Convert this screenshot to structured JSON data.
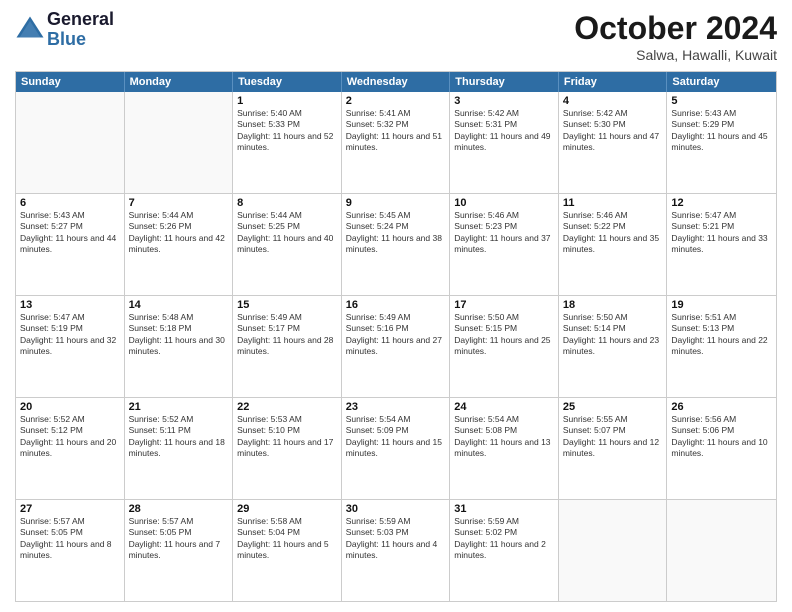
{
  "logo": {
    "line1": "General",
    "line2": "Blue"
  },
  "title": "October 2024",
  "subtitle": "Salwa, Hawalli, Kuwait",
  "days": [
    "Sunday",
    "Monday",
    "Tuesday",
    "Wednesday",
    "Thursday",
    "Friday",
    "Saturday"
  ],
  "weeks": [
    [
      {
        "day": "",
        "sunrise": "",
        "sunset": "",
        "daylight": "",
        "empty": true
      },
      {
        "day": "",
        "sunrise": "",
        "sunset": "",
        "daylight": "",
        "empty": true
      },
      {
        "day": "1",
        "sunrise": "Sunrise: 5:40 AM",
        "sunset": "Sunset: 5:33 PM",
        "daylight": "Daylight: 11 hours and 52 minutes."
      },
      {
        "day": "2",
        "sunrise": "Sunrise: 5:41 AM",
        "sunset": "Sunset: 5:32 PM",
        "daylight": "Daylight: 11 hours and 51 minutes."
      },
      {
        "day": "3",
        "sunrise": "Sunrise: 5:42 AM",
        "sunset": "Sunset: 5:31 PM",
        "daylight": "Daylight: 11 hours and 49 minutes."
      },
      {
        "day": "4",
        "sunrise": "Sunrise: 5:42 AM",
        "sunset": "Sunset: 5:30 PM",
        "daylight": "Daylight: 11 hours and 47 minutes."
      },
      {
        "day": "5",
        "sunrise": "Sunrise: 5:43 AM",
        "sunset": "Sunset: 5:29 PM",
        "daylight": "Daylight: 11 hours and 45 minutes."
      }
    ],
    [
      {
        "day": "6",
        "sunrise": "Sunrise: 5:43 AM",
        "sunset": "Sunset: 5:27 PM",
        "daylight": "Daylight: 11 hours and 44 minutes."
      },
      {
        "day": "7",
        "sunrise": "Sunrise: 5:44 AM",
        "sunset": "Sunset: 5:26 PM",
        "daylight": "Daylight: 11 hours and 42 minutes."
      },
      {
        "day": "8",
        "sunrise": "Sunrise: 5:44 AM",
        "sunset": "Sunset: 5:25 PM",
        "daylight": "Daylight: 11 hours and 40 minutes."
      },
      {
        "day": "9",
        "sunrise": "Sunrise: 5:45 AM",
        "sunset": "Sunset: 5:24 PM",
        "daylight": "Daylight: 11 hours and 38 minutes."
      },
      {
        "day": "10",
        "sunrise": "Sunrise: 5:46 AM",
        "sunset": "Sunset: 5:23 PM",
        "daylight": "Daylight: 11 hours and 37 minutes."
      },
      {
        "day": "11",
        "sunrise": "Sunrise: 5:46 AM",
        "sunset": "Sunset: 5:22 PM",
        "daylight": "Daylight: 11 hours and 35 minutes."
      },
      {
        "day": "12",
        "sunrise": "Sunrise: 5:47 AM",
        "sunset": "Sunset: 5:21 PM",
        "daylight": "Daylight: 11 hours and 33 minutes."
      }
    ],
    [
      {
        "day": "13",
        "sunrise": "Sunrise: 5:47 AM",
        "sunset": "Sunset: 5:19 PM",
        "daylight": "Daylight: 11 hours and 32 minutes."
      },
      {
        "day": "14",
        "sunrise": "Sunrise: 5:48 AM",
        "sunset": "Sunset: 5:18 PM",
        "daylight": "Daylight: 11 hours and 30 minutes."
      },
      {
        "day": "15",
        "sunrise": "Sunrise: 5:49 AM",
        "sunset": "Sunset: 5:17 PM",
        "daylight": "Daylight: 11 hours and 28 minutes."
      },
      {
        "day": "16",
        "sunrise": "Sunrise: 5:49 AM",
        "sunset": "Sunset: 5:16 PM",
        "daylight": "Daylight: 11 hours and 27 minutes."
      },
      {
        "day": "17",
        "sunrise": "Sunrise: 5:50 AM",
        "sunset": "Sunset: 5:15 PM",
        "daylight": "Daylight: 11 hours and 25 minutes."
      },
      {
        "day": "18",
        "sunrise": "Sunrise: 5:50 AM",
        "sunset": "Sunset: 5:14 PM",
        "daylight": "Daylight: 11 hours and 23 minutes."
      },
      {
        "day": "19",
        "sunrise": "Sunrise: 5:51 AM",
        "sunset": "Sunset: 5:13 PM",
        "daylight": "Daylight: 11 hours and 22 minutes."
      }
    ],
    [
      {
        "day": "20",
        "sunrise": "Sunrise: 5:52 AM",
        "sunset": "Sunset: 5:12 PM",
        "daylight": "Daylight: 11 hours and 20 minutes."
      },
      {
        "day": "21",
        "sunrise": "Sunrise: 5:52 AM",
        "sunset": "Sunset: 5:11 PM",
        "daylight": "Daylight: 11 hours and 18 minutes."
      },
      {
        "day": "22",
        "sunrise": "Sunrise: 5:53 AM",
        "sunset": "Sunset: 5:10 PM",
        "daylight": "Daylight: 11 hours and 17 minutes."
      },
      {
        "day": "23",
        "sunrise": "Sunrise: 5:54 AM",
        "sunset": "Sunset: 5:09 PM",
        "daylight": "Daylight: 11 hours and 15 minutes."
      },
      {
        "day": "24",
        "sunrise": "Sunrise: 5:54 AM",
        "sunset": "Sunset: 5:08 PM",
        "daylight": "Daylight: 11 hours and 13 minutes."
      },
      {
        "day": "25",
        "sunrise": "Sunrise: 5:55 AM",
        "sunset": "Sunset: 5:07 PM",
        "daylight": "Daylight: 11 hours and 12 minutes."
      },
      {
        "day": "26",
        "sunrise": "Sunrise: 5:56 AM",
        "sunset": "Sunset: 5:06 PM",
        "daylight": "Daylight: 11 hours and 10 minutes."
      }
    ],
    [
      {
        "day": "27",
        "sunrise": "Sunrise: 5:57 AM",
        "sunset": "Sunset: 5:05 PM",
        "daylight": "Daylight: 11 hours and 8 minutes."
      },
      {
        "day": "28",
        "sunrise": "Sunrise: 5:57 AM",
        "sunset": "Sunset: 5:05 PM",
        "daylight": "Daylight: 11 hours and 7 minutes."
      },
      {
        "day": "29",
        "sunrise": "Sunrise: 5:58 AM",
        "sunset": "Sunset: 5:04 PM",
        "daylight": "Daylight: 11 hours and 5 minutes."
      },
      {
        "day": "30",
        "sunrise": "Sunrise: 5:59 AM",
        "sunset": "Sunset: 5:03 PM",
        "daylight": "Daylight: 11 hours and 4 minutes."
      },
      {
        "day": "31",
        "sunrise": "Sunrise: 5:59 AM",
        "sunset": "Sunset: 5:02 PM",
        "daylight": "Daylight: 11 hours and 2 minutes."
      },
      {
        "day": "",
        "sunrise": "",
        "sunset": "",
        "daylight": "",
        "empty": true
      },
      {
        "day": "",
        "sunrise": "",
        "sunset": "",
        "daylight": "",
        "empty": true
      }
    ]
  ]
}
